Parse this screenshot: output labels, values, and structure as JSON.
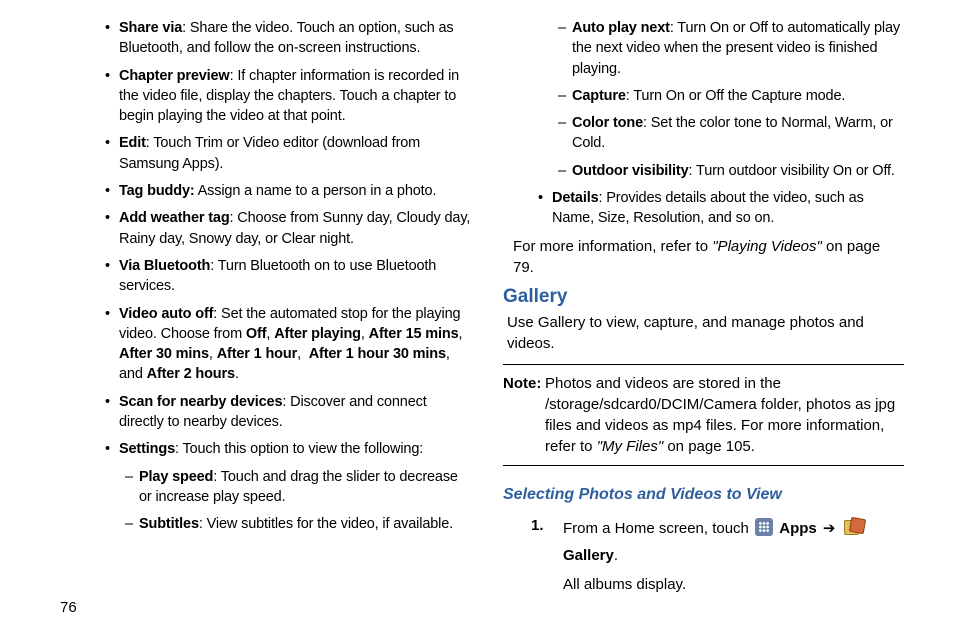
{
  "left": {
    "items": [
      {
        "bold": "Share via",
        "text": ": Share the video. Touch an option, such as Bluetooth, and follow the on-screen instructions."
      },
      {
        "bold": "Chapter preview",
        "text": ": If chapter information is recorded in the video file, display the chapters. Touch a chapter to begin playing the video at that point."
      },
      {
        "bold": "Edit",
        "text": ": Touch Trim or Video editor (download from Samsung Apps)."
      },
      {
        "bold": "Tag buddy:",
        "text": " Assign a name to a person in a photo."
      },
      {
        "bold": "Add weather tag",
        "text": ": Choose from Sunny day, Cloudy day, Rainy day, Snowy day, or Clear night."
      },
      {
        "bold": "Via Bluetooth",
        "text": ": Turn Bluetooth on to use Bluetooth services."
      }
    ],
    "video_auto_off": {
      "bold": "Video auto off",
      "lead": ": Set the automated stop for the playing video. Choose from ",
      "opts": [
        "Off",
        "After playing",
        "After 15 mins",
        "After 30 mins",
        "After 1 hour",
        "After 1 hour 30 mins",
        "After 2 hours"
      ],
      "sep": ", ",
      "and": ", and ",
      "tail": "."
    },
    "scan": {
      "bold": "Scan for nearby devices",
      "text": ": Discover and connect directly to nearby devices."
    },
    "settings": {
      "bold": "Settings",
      "text": ": Touch this option to view the following:"
    },
    "subitems": [
      {
        "bold": "Play speed",
        "text": ": Touch and drag the slider to decrease or increase play speed."
      },
      {
        "bold": "Subtitles",
        "text": ": View subtitles for the video, if available."
      }
    ]
  },
  "right": {
    "subitems": [
      {
        "bold": "Auto play next",
        "text": ": Turn On or Off to automatically play the next video when the present video is finished playing."
      },
      {
        "bold": "Capture",
        "text": ": Turn On or Off the Capture mode."
      },
      {
        "bold": "Color tone",
        "text": ": Set the color tone to Normal, Warm, or Cold."
      },
      {
        "bold": "Outdoor visibility",
        "text": ": Turn outdoor visibility On or Off."
      }
    ],
    "details": {
      "bold": "Details",
      "text": ": Provides details about the video, such as Name, Size, Resolution, and so on."
    },
    "ref_lead": "For more information, refer to ",
    "ref_title": "\"Playing Videos\"",
    "ref_tail": " on page 79.",
    "heading": "Gallery",
    "gallery_desc": "Use Gallery to view, capture, and manage photos and videos.",
    "note_label": "Note:",
    "note_body_a": "Photos and videos are stored in the /storage/sdcard0/DCIM/Camera folder, photos as jpg files and videos as mp4 files. For more information, refer to ",
    "note_ref": "\"My Files\"",
    "note_body_b": " on page 105.",
    "subheading": "Selecting Photos and Videos to View",
    "step_num": "1.",
    "step_lead": "From a Home screen, touch ",
    "apps_label": "Apps",
    "arrow": "➔",
    "gallery_label": "Gallery",
    "step_tail": ".",
    "step_line2": "All albums display."
  },
  "page_number": "76"
}
